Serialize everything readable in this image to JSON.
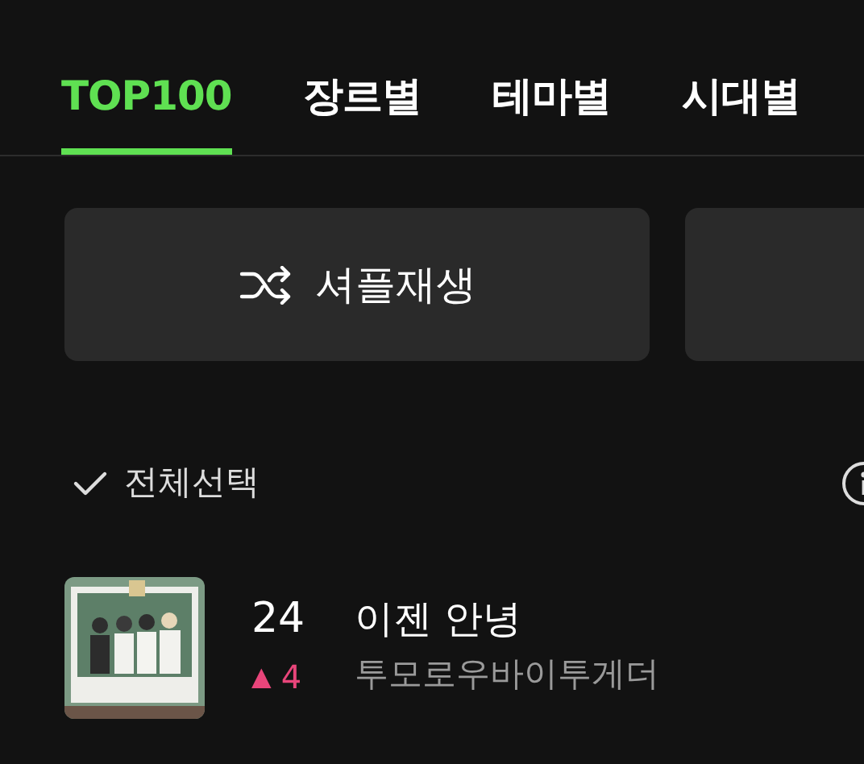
{
  "tabs": [
    {
      "label": "TOP100",
      "selected": true
    },
    {
      "label": "장르별",
      "selected": false
    },
    {
      "label": "테마별",
      "selected": false
    },
    {
      "label": "시대별",
      "selected": false
    }
  ],
  "buttons": [
    {
      "kind": "shuffle",
      "label": "셔플재생"
    },
    {
      "kind": "blank"
    }
  ],
  "select_all": {
    "label": "전체선택",
    "checked": true
  },
  "songs": [
    {
      "rank": "24",
      "title": "이젠 안녕",
      "artist": "투모로우바이투게더",
      "change": {
        "marker": "▲",
        "amount": "4"
      }
    }
  ]
}
